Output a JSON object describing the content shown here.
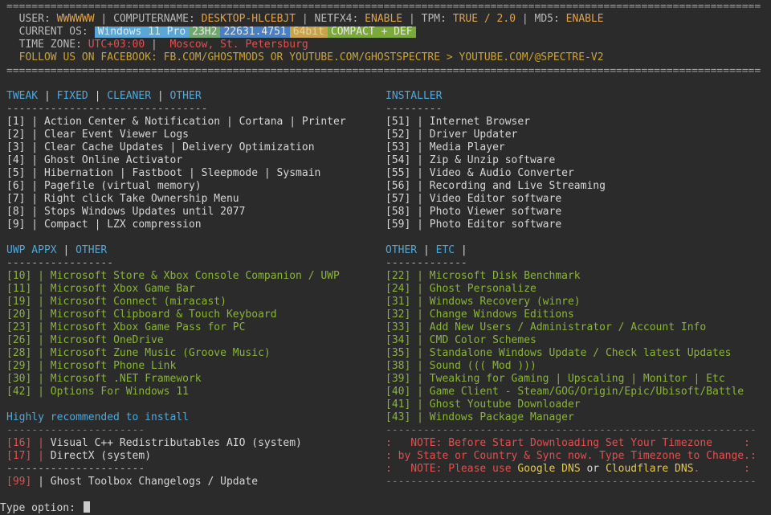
{
  "header": {
    "rule_eq": "========================================================================================================================",
    "user_label": "USER:",
    "user_value": "WWWWWW",
    "computername_label": "COMPUTERNAME:",
    "computername_value": "DESKTOP-HLCEBJT",
    "netfx4_label": "NETFX4:",
    "netfx4_value": "ENABLE",
    "tpm_label": "TPM:",
    "tpm_value": "TRUE / 2.0",
    "md5_label": "MD5:",
    "md5_value": "ENABLE",
    "os_label": "CURRENT OS:",
    "os_tags": [
      "Windows 11 Pro",
      "23H2",
      "22631.4751",
      "64bit",
      "COMPACT + DEF"
    ],
    "tz_label": "TIME ZONE:",
    "tz_value": "UTC+03:00",
    "tz_city": "Moscow, St. Petersburg",
    "follow": "FOLLOW US ON FACEBOOK: FB.COM/GHOSTMODS OR YOUTUBE.COM/GHOSTSPECTRE > YOUTUBE.COM/@SPECTRE-V2"
  },
  "tweak": {
    "title_parts": [
      "TWEAK",
      "FIXED",
      "CLEANER",
      "OTHER"
    ],
    "rule": "--------------------------------",
    "items": [
      {
        "num": "[1]",
        "label": "Action Center & Notification | Cortana | Printer"
      },
      {
        "num": "[2]",
        "label": "Clear Event Viewer Logs"
      },
      {
        "num": "[3]",
        "label": "Clear Cache Updates | Delivery Optimization"
      },
      {
        "num": "[4]",
        "label": "Ghost Online Activator"
      },
      {
        "num": "[5]",
        "label": "Hibernation | Fastboot | Sleepmode | Sysmain"
      },
      {
        "num": "[6]",
        "label": "Pagefile (virtual memory)"
      },
      {
        "num": "[7]",
        "label": "Right click Take Ownership Menu"
      },
      {
        "num": "[8]",
        "label": "Stops Windows Updates until 2077"
      },
      {
        "num": "[9]",
        "label": "Compact | LZX compression"
      }
    ]
  },
  "installer": {
    "title": "INSTALLER",
    "rule": "---------",
    "items": [
      {
        "num": "[51]",
        "label": "Internet Browser"
      },
      {
        "num": "[52]",
        "label": "Driver Updater"
      },
      {
        "num": "[53]",
        "label": "Media Player"
      },
      {
        "num": "[54]",
        "label": "Zip & Unzip software"
      },
      {
        "num": "[55]",
        "label": "Video & Audio Converter"
      },
      {
        "num": "[56]",
        "label": "Recording and Live Streaming"
      },
      {
        "num": "[57]",
        "label": "Video Editor software"
      },
      {
        "num": "[58]",
        "label": "Photo Viewer software"
      },
      {
        "num": "[59]",
        "label": "Photo Editor software"
      }
    ]
  },
  "uwp": {
    "title_parts": [
      "UWP APPX",
      "OTHER"
    ],
    "rule": "-----------------",
    "items": [
      {
        "num": "[10]",
        "label": "Microsoft Store & Xbox Console Companion / UWP"
      },
      {
        "num": "[11]",
        "label": "Microsoft Xbox Game Bar"
      },
      {
        "num": "[19]",
        "label": "Microsoft Connect (miracast)"
      },
      {
        "num": "[20]",
        "label": "Microsoft Clipboard & Touch Keyboard"
      },
      {
        "num": "[23]",
        "label": "Microsoft Xbox Game Pass for PC"
      },
      {
        "num": "[26]",
        "label": "Microsoft OneDrive"
      },
      {
        "num": "[28]",
        "label": "Microsoft Zune Music (Groove Music)"
      },
      {
        "num": "[29]",
        "label": "Microsoft Phone Link"
      },
      {
        "num": "[30]",
        "label": "Microsoft .NET Framework"
      },
      {
        "num": "[42]",
        "label": "Options For Windows 11"
      }
    ]
  },
  "other": {
    "title_parts": [
      "OTHER",
      "ETC",
      ""
    ],
    "rule": "-------------",
    "items": [
      {
        "num": "[22]",
        "label": "Microsoft Disk Benchmark"
      },
      {
        "num": "[24]",
        "label": "Ghost Personalize"
      },
      {
        "num": "[31]",
        "label": "Windows Recovery (winre)"
      },
      {
        "num": "[32]",
        "label": "Change Windows Editions"
      },
      {
        "num": "[33]",
        "label": "Add New Users / Administrator / Account Info"
      },
      {
        "num": "[34]",
        "label": "CMD Color Schemes"
      },
      {
        "num": "[35]",
        "label": "Standalone Windows Update / Check latest Updates"
      },
      {
        "num": "[38]",
        "label": "Sound ((( Mod )))"
      },
      {
        "num": "[39]",
        "label": "Tweaking for Gaming | Upscaling | Monitor | Etc"
      },
      {
        "num": "[40]",
        "label": "Game Client - Steam/GOG/Origin/Epic/Ubisoft/Battle"
      },
      {
        "num": "[41]",
        "label": "Ghost Youtube Downloader"
      },
      {
        "num": "[43]",
        "label": "Windows Package Manager"
      }
    ]
  },
  "recommended": {
    "title": "Highly recommended to install",
    "rule": "----------------------",
    "items": [
      {
        "num": "[16]",
        "label": "Visual C++ Redistributables AIO (system)"
      },
      {
        "num": "[17]",
        "label": "DirectX (system)"
      }
    ],
    "changelog": {
      "num": "[99]",
      "label": "Ghost Toolbox Changelogs / Update"
    }
  },
  "note": {
    "rule": "-----------------------------------------------------------",
    "line1": ":   NOTE: Before Start Downloading Set Your Timezone     :",
    "line2": ": by State or Country & Sync now. Type Timezone to Change.:",
    "line3_pre": ":   NOTE: Please use ",
    "google": "Google DNS",
    "or": " or ",
    "cloudflare": "Cloudflare DNS",
    "line3_post": ".       :"
  },
  "prompt": {
    "label": "Type option:"
  },
  "colors": {
    "background": "#2b2b2b",
    "blue": "#4fa8d8",
    "green": "#8ab33a",
    "orange": "#e0a24a",
    "red": "#e05050"
  }
}
